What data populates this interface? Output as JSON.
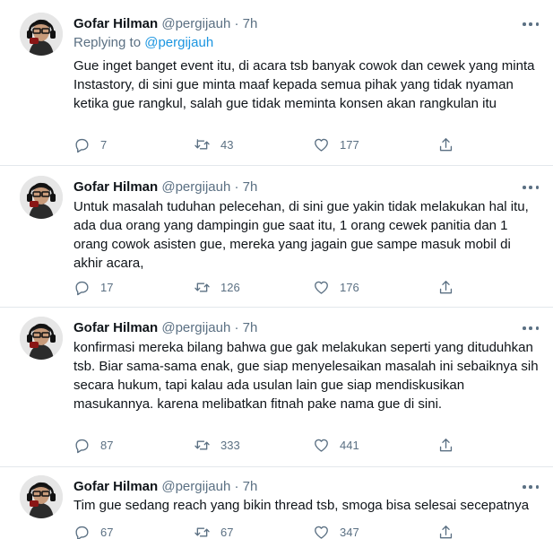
{
  "tweets": [
    {
      "name": "Gofar Hilman",
      "handle": "@pergijauh",
      "dot": "·",
      "time": "7h",
      "replying_prefix": "Replying to ",
      "replying_to": "@pergijauh",
      "text": "Gue inget banget event itu, di acara tsb banyak cowok dan cewek yang minta Instastory, di sini gue minta maaf kepada semua pihak yang tidak nyaman ketika gue rangkul, salah gue tidak meminta konsen akan rangkulan itu",
      "replies": "7",
      "retweets": "43",
      "likes": "177"
    },
    {
      "name": "Gofar Hilman",
      "handle": "@pergijauh",
      "dot": "·",
      "time": "7h",
      "text": "Untuk masalah tuduhan pelecehan, di sini gue yakin tidak melakukan hal itu, ada dua orang yang dampingin gue saat itu, 1 orang cewek panitia dan 1 orang cowok asisten gue,  mereka yang jagain gue sampe masuk mobil di akhir acara,",
      "replies": "17",
      "retweets": "126",
      "likes": "176"
    },
    {
      "name": "Gofar Hilman",
      "handle": "@pergijauh",
      "dot": "·",
      "time": "7h",
      "text": "konfirmasi mereka bilang bahwa gue gak melakukan seperti yang dituduhkan tsb. Biar sama-sama enak, gue siap menyelesaikan masalah ini sebaiknya sih secara hukum, tapi kalau ada usulan lain gue siap mendiskusikan masukannya. karena melibatkan fitnah pake nama gue di sini.",
      "replies": "87",
      "retweets": "333",
      "likes": "441"
    },
    {
      "name": "Gofar Hilman",
      "handle": "@pergijauh",
      "dot": "·",
      "time": "7h",
      "text": "Tim gue sedang reach yang bikin thread tsb, smoga bisa selesai secepatnya",
      "replies": "67",
      "retweets": "67",
      "likes": "347"
    }
  ],
  "icons": {
    "reply": "reply-icon",
    "retweet": "retweet-icon",
    "like": "like-icon",
    "share": "share-icon",
    "more": "more-icon"
  },
  "colors": {
    "text": "#0f1419",
    "secondary": "#5b7083",
    "mention": "#1b95e0",
    "divider": "#e3e8ec"
  }
}
